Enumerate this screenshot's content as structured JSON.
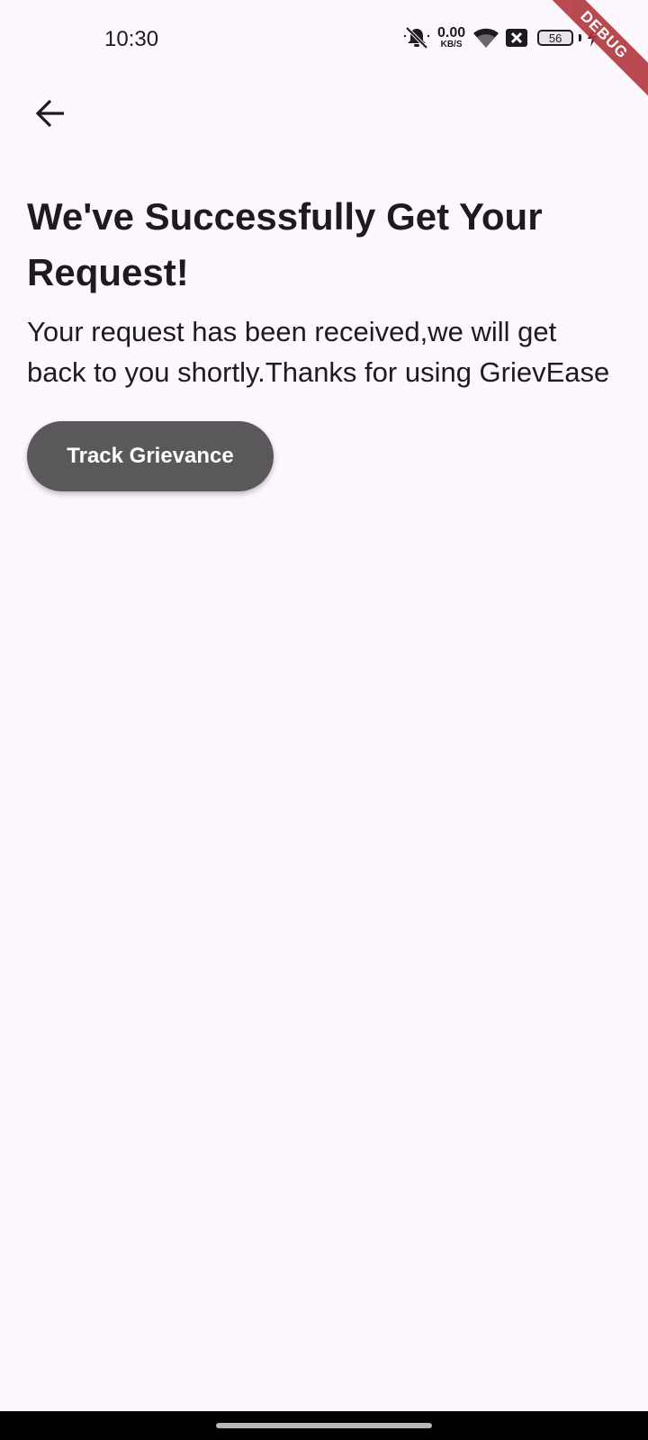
{
  "status_bar": {
    "time": "10:30",
    "net_speed_value": "0.00",
    "net_speed_unit": "KB/S",
    "battery_level": "56",
    "icons": [
      "bell-muted-icon",
      "wifi-icon",
      "close-box-icon",
      "battery-icon",
      "charging-icon"
    ]
  },
  "debug_banner": "DEBUG",
  "nav": {
    "back_icon": "arrow-left-icon"
  },
  "main": {
    "headline": "We've Successfully Get Your Request!",
    "message": "Your request has been received,we will get back to you shortly.Thanks for using GrievEase",
    "track_button_label": "Track Grievance"
  },
  "colors": {
    "background": "#fdf7fd",
    "text": "#1d1b20",
    "button": "#5a585b",
    "button_text": "#ffffff",
    "debug_ribbon": "#b0383f"
  }
}
